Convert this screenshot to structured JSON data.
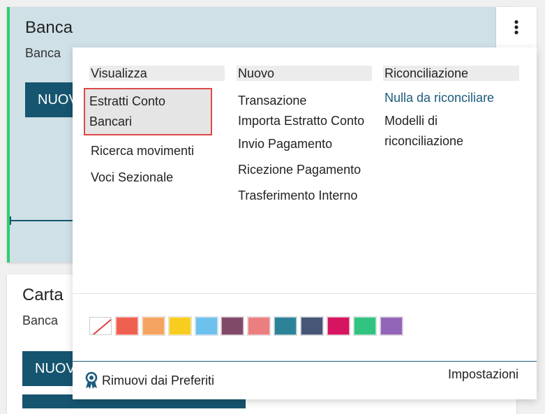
{
  "cards": [
    {
      "title": "Banca",
      "subtitle": "Banca",
      "button": "Nuovo"
    },
    {
      "title": "Carta",
      "subtitle": "Banca",
      "button": "Nuovo"
    }
  ],
  "icons": {
    "menu": "kebab-menu-icon",
    "favorite": "ribbon-badge-icon"
  },
  "menu": {
    "columns": [
      {
        "header": "Visualizza",
        "items": [
          "Estratti Conto Bancari",
          "Ricerca movimenti",
          "Voci Sezionale"
        ]
      },
      {
        "header": "Nuovo",
        "items": [
          "Transazione",
          "Importa Estratto Conto",
          "Invio Pagamento",
          "Ricezione Pagamento",
          "Trasferimento Interno"
        ]
      },
      {
        "header": "Riconciliazione",
        "items": [
          "Nulla da riconciliare",
          "Modelli di riconciliazione"
        ]
      }
    ],
    "colors": [
      "#ffffff",
      "#f06050",
      "#f4a460",
      "#f7cd1f",
      "#6cc1ed",
      "#814968",
      "#eb7e7f",
      "#2c8397",
      "#475577",
      "#d6145f",
      "#30c381",
      "#9365b8"
    ],
    "footer": {
      "remove_favorite": "Rimuovi dai Preferiti",
      "settings": "Impostazioni"
    }
  },
  "accent": {
    "primary": "#16556f",
    "highlight_border": "#e04848",
    "card_stripe": "#2ecc71"
  }
}
